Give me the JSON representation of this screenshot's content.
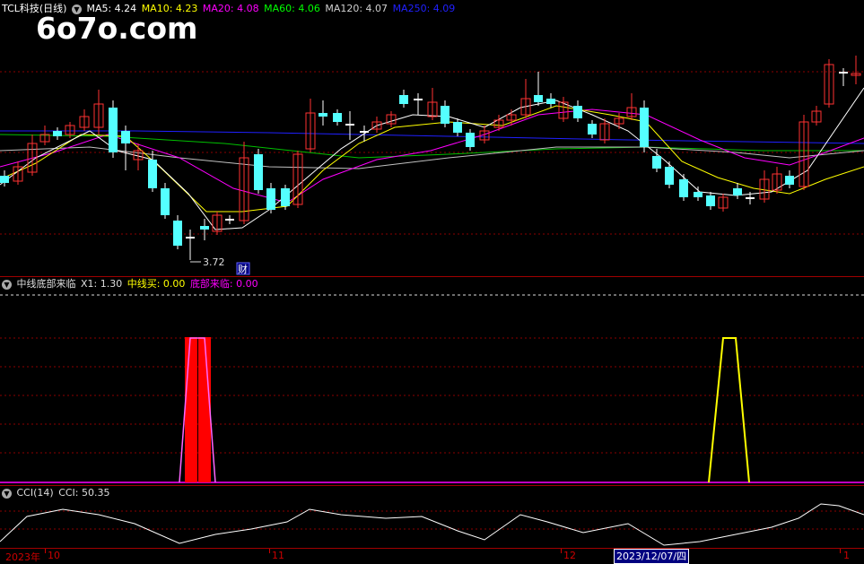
{
  "main": {
    "stock_label": "TCL科技(日线)",
    "ma": [
      {
        "label": "MA5: 4.24",
        "color": "#ffffff"
      },
      {
        "label": "MA10: 4.23",
        "color": "#ffff00"
      },
      {
        "label": "MA20: 4.08",
        "color": "#ff00ff"
      },
      {
        "label": "MA60: 4.06",
        "color": "#00ff00"
      },
      {
        "label": "MA120: 4.07",
        "color": "#d0d0d0"
      },
      {
        "label": "MA250: 4.09",
        "color": "#0000ff"
      }
    ],
    "low_marker": "3.72",
    "finance_marker": "财",
    "watermark": "6o7o.com"
  },
  "indicator": {
    "title": "中线底部来临",
    "x1": "X1: 1.30",
    "buy": "中线买: 0.00",
    "bottom": "底部来临: 0.00",
    "buy_color": "#ffff00",
    "bottom_color": "#ff00ff"
  },
  "cci": {
    "title": "CCI(14)",
    "value": "CCI: 50.35"
  },
  "xaxis": {
    "labels": [
      "2023年",
      "10",
      "11",
      "12",
      "1"
    ],
    "cursor_date": "2023/12/07/四"
  },
  "colors": {
    "up": "#ff3232",
    "down": "#54ffff",
    "grid": "#8b0000"
  }
}
